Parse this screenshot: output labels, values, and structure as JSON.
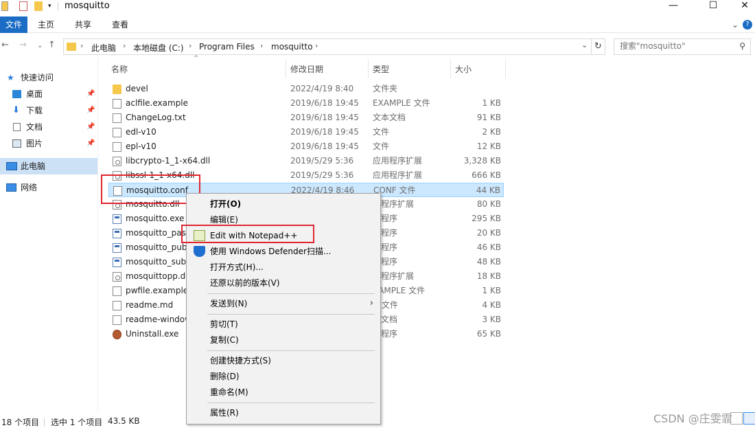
{
  "window": {
    "title": "mosquitto",
    "controls": {
      "minimize": "—",
      "maximize": "☐",
      "close": "✕"
    },
    "help": "?",
    "ribbon_toggle": "⌄"
  },
  "ribbon": {
    "tabs": [
      "文件",
      "主页",
      "共享",
      "查看"
    ]
  },
  "nav": {
    "back": "←",
    "forward": "→",
    "recent": "⌄",
    "up": "↑",
    "breadcrumb": [
      "此电脑",
      "本地磁盘 (C:)",
      "Program Files",
      "mosquitto"
    ],
    "crumb_sep": "›",
    "dropdown": "⌄",
    "refresh": "↻",
    "search_placeholder": "搜索\"mosquitto\"",
    "search_icon": "⚲"
  },
  "sidebar": {
    "pin_icon": "📌",
    "items": [
      {
        "label": "快速访问",
        "icon": "star-icon"
      },
      {
        "label": "桌面",
        "icon": "desktop-icon",
        "pinned": true
      },
      {
        "label": "下载",
        "icon": "download-icon",
        "pinned": true
      },
      {
        "label": "文档",
        "icon": "documents-icon",
        "pinned": true
      },
      {
        "label": "图片",
        "icon": "pictures-icon",
        "pinned": true
      },
      {
        "label": "此电脑",
        "icon": "computer-icon",
        "selected": true
      },
      {
        "label": "网络",
        "icon": "network-icon"
      }
    ]
  },
  "columns": {
    "name": "名称",
    "modified": "修改日期",
    "type": "类型",
    "size": "大小",
    "sort_caret": "^"
  },
  "files": [
    {
      "name": "devel",
      "modified": "2022/4/19 8:40",
      "type": "文件夹",
      "size": "",
      "icon": "folder-icon"
    },
    {
      "name": "aclfile.example",
      "modified": "2019/6/18 19:45",
      "type": "EXAMPLE 文件",
      "size": "1 KB",
      "icon": "file-icon"
    },
    {
      "name": "ChangeLog.txt",
      "modified": "2019/6/18 19:45",
      "type": "文本文档",
      "size": "91 KB",
      "icon": "text-file-icon"
    },
    {
      "name": "edl-v10",
      "modified": "2019/6/18 19:45",
      "type": "文件",
      "size": "2 KB",
      "icon": "file-icon"
    },
    {
      "name": "epl-v10",
      "modified": "2019/6/18 19:45",
      "type": "文件",
      "size": "12 KB",
      "icon": "file-icon"
    },
    {
      "name": "libcrypto-1_1-x64.dll",
      "modified": "2019/5/29 5:36",
      "type": "应用程序扩展",
      "size": "3,328 KB",
      "icon": "dll-icon"
    },
    {
      "name": "libssl-1_1-x64.dll",
      "modified": "2019/5/29 5:36",
      "type": "应用程序扩展",
      "size": "666 KB",
      "icon": "dll-icon"
    },
    {
      "name": "mosquitto.conf",
      "modified": "2022/4/19 8:46",
      "type": "CONF 文件",
      "size": "44 KB",
      "icon": "conf-file-icon",
      "selected": true
    },
    {
      "name": "mosquitto.dll",
      "modified": "",
      "type": "用程序扩展",
      "size": "80 KB",
      "icon": "dll-icon"
    },
    {
      "name": "mosquitto.exe",
      "modified": "",
      "type": "用程序",
      "size": "295 KB",
      "icon": "app-icon"
    },
    {
      "name": "mosquitto_passwd.exe",
      "modified": "",
      "type": "用程序",
      "size": "20 KB",
      "icon": "app-icon"
    },
    {
      "name": "mosquitto_pub.exe",
      "modified": "",
      "type": "用程序",
      "size": "46 KB",
      "icon": "app-icon"
    },
    {
      "name": "mosquitto_sub.exe",
      "modified": "",
      "type": "用程序",
      "size": "48 KB",
      "icon": "app-icon"
    },
    {
      "name": "mosquittopp.dll",
      "modified": "",
      "type": "用程序扩展",
      "size": "18 KB",
      "icon": "dll-icon"
    },
    {
      "name": "pwfile.example",
      "modified": "",
      "type": "XAMPLE 文件",
      "size": "1 KB",
      "icon": "file-icon"
    },
    {
      "name": "readme.md",
      "modified": "",
      "type": "D 文件",
      "size": "4 KB",
      "icon": "file-icon"
    },
    {
      "name": "readme-windows.txt",
      "modified": "",
      "type": "本文档",
      "size": "3 KB",
      "icon": "text-file-icon"
    },
    {
      "name": "Uninstall.exe",
      "modified": "",
      "type": "用程序",
      "size": "65 KB",
      "icon": "uninstall-icon"
    }
  ],
  "context_menu": [
    {
      "label": "打开(O)",
      "bold": true
    },
    {
      "label": "编辑(E)"
    },
    {
      "label": "Edit with Notepad++",
      "icon": "notepad-plus-plus-icon",
      "highlighted": true
    },
    {
      "label": "使用 Windows Defender扫描...",
      "icon": "windows-defender-icon"
    },
    {
      "label": "打开方式(H)..."
    },
    {
      "label": "还原以前的版本(V)"
    },
    {
      "separator": true
    },
    {
      "label": "发送到(N)",
      "submenu": true,
      "arrow": "›"
    },
    {
      "separator": true
    },
    {
      "label": "剪切(T)"
    },
    {
      "label": "复制(C)"
    },
    {
      "separator": true
    },
    {
      "label": "创建快捷方式(S)"
    },
    {
      "label": "删除(D)"
    },
    {
      "label": "重命名(M)"
    },
    {
      "separator": true
    },
    {
      "label": "属性(R)"
    }
  ],
  "status": {
    "count": "18 个项目",
    "selection": "选中 1 个项目",
    "size": "43.5 KB"
  },
  "watermark": "CSDN @庄雯霏",
  "colors": {
    "accent": "#1a6cc4",
    "selection": "#cce8ff",
    "highlight_box": "#e0252f"
  }
}
